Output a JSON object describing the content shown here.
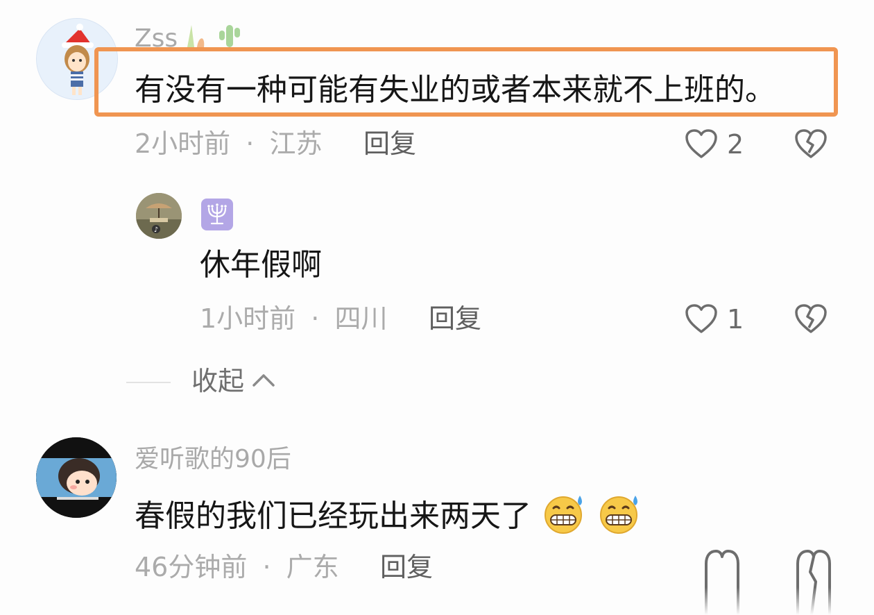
{
  "comments": [
    {
      "username": "Zss",
      "text": "有没有一种可能有失业的或者本来就不上班的。",
      "time": "2小时前",
      "location": "江苏",
      "reply_label": "回复",
      "likes": "2"
    },
    {
      "username": "",
      "text": "休年假啊",
      "time": "1小时前",
      "location": "四川",
      "reply_label": "回复",
      "likes": "1"
    },
    {
      "username": "爱听歌的90后",
      "text": "春假的我们已经玩出来两天了",
      "time": "46分钟前",
      "location": "广东",
      "reply_label": "回复",
      "likes": ""
    }
  ],
  "collapse_label": "收起",
  "separator": "·",
  "colors": {
    "highlight": "#f09551",
    "badge": "#b3a6e6",
    "meta": "#ababab"
  },
  "icons": {
    "like": "heart-outline-icon",
    "dislike": "broken-heart-icon",
    "collapse": "chevron-up-icon",
    "emoji": "grimacing-sweat-emoji"
  }
}
